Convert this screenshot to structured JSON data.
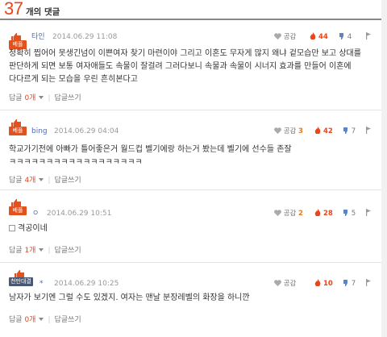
{
  "header": {
    "count": "37",
    "title": "개의 댓글"
  },
  "labels": {
    "like": "공감",
    "reply": "답글",
    "write_reply": "답글쓰기"
  },
  "colors": {
    "accent": "#e8461b",
    "author": "#4f6bb1",
    "badge_best": "#e2521e",
    "badge_other": "#4a5873"
  },
  "comments": [
    {
      "badge": "베플",
      "author": "타인",
      "date": "2014.06.29 11:08",
      "like_count": "",
      "hot_count": "44",
      "dislike_count": "4",
      "text": "정확히 찝어어 못생긴넘이 이쁜여자 찾기 마련이야 그리고 이혼도 무자게 많지 왜냐 겉모습만 보고 상대를 판단하게 되면 보통 여자애들도 속물이 잘걸려 그러다보니 속물과 속물이 시너지 효과를 만들어 이혼에 다다르게 되는 모습을 우린 흔히본다고",
      "reply_count": "0개"
    },
    {
      "badge": "베플",
      "author": "bing",
      "date": "2014.06.29 04:04",
      "like_count": "3",
      "hot_count": "42",
      "dislike_count": "7",
      "text": "학교가기전에 아빠가 틀어좋은거 월드컵 벨기에랑 하는거 봤는데 벨기에 선수들 존잘 ㅋㅋㅋㅋㅋㅋㅋㅋㅋㅋㅋㅋㅋㅋㅋㅋㅋㅋ",
      "reply_count": "4개"
    },
    {
      "badge": "베플",
      "author": "ㅇ",
      "date": "2014.06.29 10:51",
      "like_count": "2",
      "hot_count": "28",
      "dislike_count": "5",
      "text": "격공이네",
      "reply_count": "1개"
    },
    {
      "badge": "천만대결",
      "author": "*",
      "date": "2014.06.29 10:25",
      "like_count": "",
      "hot_count": "10",
      "dislike_count": "7",
      "text": "남자가 보기엔 그럴 수도 있겠지. 여자는 맨날 분장레벨의 화장을 하니깐",
      "reply_count": "0개"
    }
  ]
}
